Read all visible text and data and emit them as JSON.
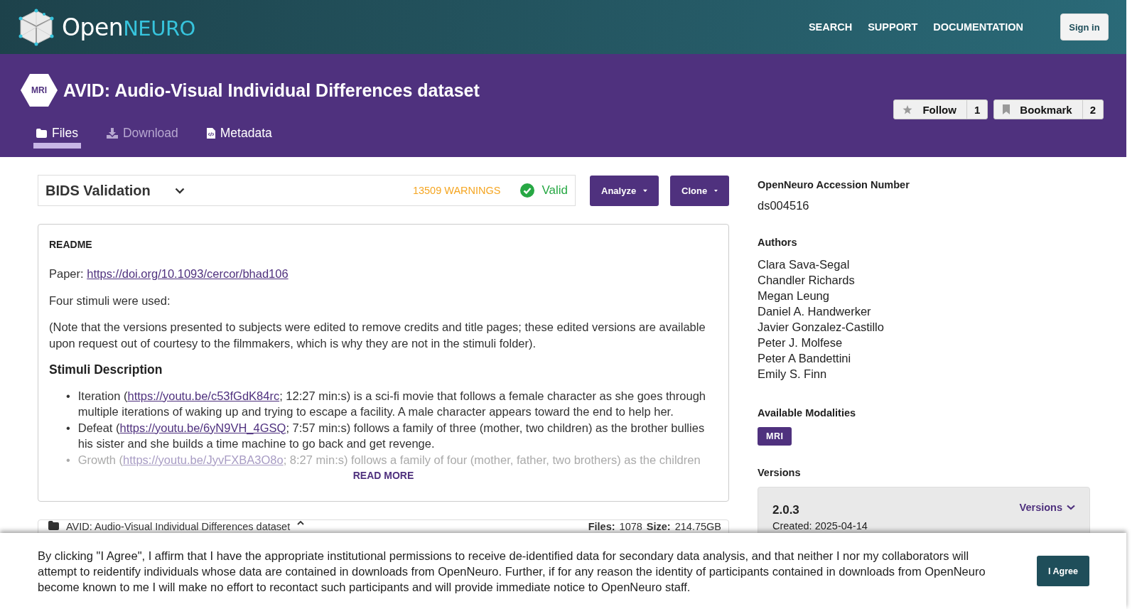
{
  "header": {
    "logo": "**Open**NEURO",
    "nav": [
      "SEARCH",
      "SUPPORT",
      "DOCUMENTATION"
    ],
    "sign_in": "Sign in"
  },
  "dataset": {
    "modality_badge": "MRI",
    "title": "AVID: Audio-Visual Individual Differences dataset",
    "follow": {
      "label": "Follow",
      "count": "1"
    },
    "bookmark": {
      "label": "Bookmark",
      "count": "2"
    },
    "tabs": [
      {
        "label": "Files",
        "selected": true,
        "disabled": false
      },
      {
        "label": "Download",
        "selected": false,
        "disabled": true
      },
      {
        "label": "Metadata",
        "selected": false,
        "disabled": false
      }
    ]
  },
  "validation": {
    "title": "BIDS Validation",
    "warnings": "13509 WARNINGS",
    "status": "Valid"
  },
  "actions": [
    {
      "label": "Analyze"
    },
    {
      "label": "Clone"
    }
  ],
  "readme": {
    "heading": "README",
    "blocks": [
      {
        "kind": "paragraph",
        "parts": [
          {
            "text": "Paper: "
          },
          {
            "link": "https://doi.org/10.1093/cercor/bhad106"
          }
        ]
      },
      {
        "kind": "paragraph",
        "parts": [
          {
            "text": "Four stimuli were used:"
          }
        ]
      },
      {
        "kind": "paragraph",
        "parts": [
          {
            "text": "(Note that the versions presented to subjects were edited to remove credits and title pages; these edited versions are available upon request out of courtesy to the filmmakers, which is why they are not in the stimuli folder)."
          }
        ]
      },
      {
        "kind": "heading",
        "parts": [
          {
            "text": "Stimuli Description"
          }
        ]
      },
      {
        "kind": "list",
        "marker": "•",
        "items": [
          [
            {
              "text": "Iteration ("
            },
            {
              "link": "https://youtu.be/c53fGdK84rc"
            },
            {
              "text": "; 12:27 min:s) is a sci-fi movie that follows a female character as she goes through multiple iterations of waking up and trying to escape a facility. A male character appears toward the end to help her."
            }
          ],
          [
            {
              "text": "Defeat ("
            },
            {
              "link": "https://youtu.be/6yN9VH_4GSQ"
            },
            {
              "text": "; 7:57 min:s) follows a family of three (mother, two children) as the brother bullies his sister and she builds a time machine to go back and get revenge."
            }
          ],
          [
            {
              "text": "Growth ("
            },
            {
              "link": "https://youtu.be/JyvFXBA3O8o"
            },
            {
              "text": "; 8:27 min:s) follows a family of four (mother, father, two brothers) as the children"
            }
          ]
        ]
      }
    ],
    "read_more": "READ MORE"
  },
  "files_panel": {
    "name": "AVID: Audio-Visual Individual Differences dataset",
    "files_label": "Files:",
    "files": "1078",
    "size_label": "Size:",
    "size": "214.75GB"
  },
  "sidebar": {
    "accession": {
      "label": "OpenNeuro Accession Number",
      "value": "ds004516"
    },
    "authors": {
      "label": "Authors",
      "names": [
        "Clara Sava-Segal",
        "Chandler Richards",
        "Megan Leung",
        "Daniel A. Handwerker",
        "Javier Gonzalez-Castillo",
        "Peter J. Molfese",
        "Peter A Bandettini",
        "Emily S. Finn"
      ]
    },
    "modalities": {
      "label": "Available Modalities",
      "items": [
        "MRI"
      ]
    },
    "versions": {
      "label": "Versions",
      "current": "2.0.3",
      "created": "Created: 2025-04-14",
      "menu": "Versions"
    }
  },
  "consent": {
    "text": "By clicking \"I Agree\", I affirm that I have the appropriate institutional permissions to receive de-identified data for secondary data analysis, and that neither I nor my collaborators will attempt to reidentify individuals whose data are contained in downloads from OpenNeuro. Further, if for any reason the identity of participants contained in downloads from OpenNeuro become known to me I will make no effort to recontact such participants and will provide immediate notice to OpenNeuro staff.",
    "button": "I Agree"
  }
}
